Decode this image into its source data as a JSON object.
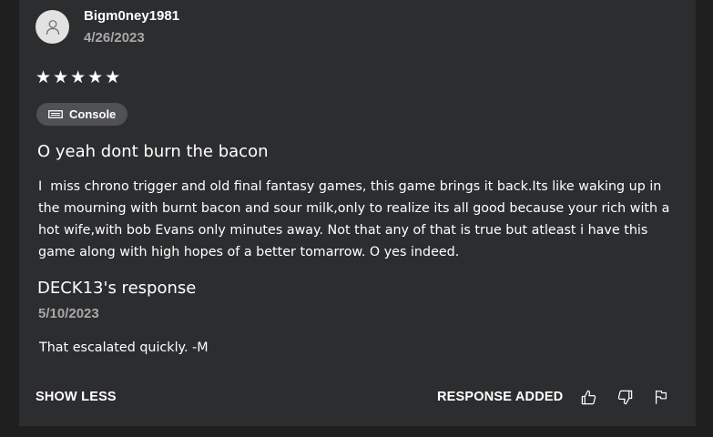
{
  "review": {
    "username": "Bigm0ney1981",
    "date": "4/26/2023",
    "rating": 5,
    "stars": [
      "★",
      "★",
      "★",
      "★",
      "★"
    ],
    "platform": {
      "label": "Console",
      "icon": "console-icon"
    },
    "title": "O yeah dont burn the bacon",
    "body": "I  miss chrono trigger and old final fantasy games, this game brings it back.Its like waking up in the mourning with burnt bacon and sour milk,only to realize its all good because your rich with a hot wife,with bob Evans only minutes away. Not that any of that is true but atleast i have this game along with high hopes of a better tomarrow. O yes indeed."
  },
  "response": {
    "title": "DECK13's response",
    "date": "5/10/2023",
    "body": "That escalated quickly. -M"
  },
  "footer": {
    "show_less_label": "SHOW LESS",
    "response_added_label": "RESPONSE ADDED",
    "actions": [
      {
        "icon": "thumbs-up-icon"
      },
      {
        "icon": "thumbs-down-icon"
      },
      {
        "icon": "flag-icon"
      }
    ]
  },
  "colors": {
    "card_background": "#2c2d2f",
    "page_background": "#1f1f1f",
    "badge_background": "#505154",
    "muted_text": "#a8a8a8",
    "text": "#ffffff"
  }
}
